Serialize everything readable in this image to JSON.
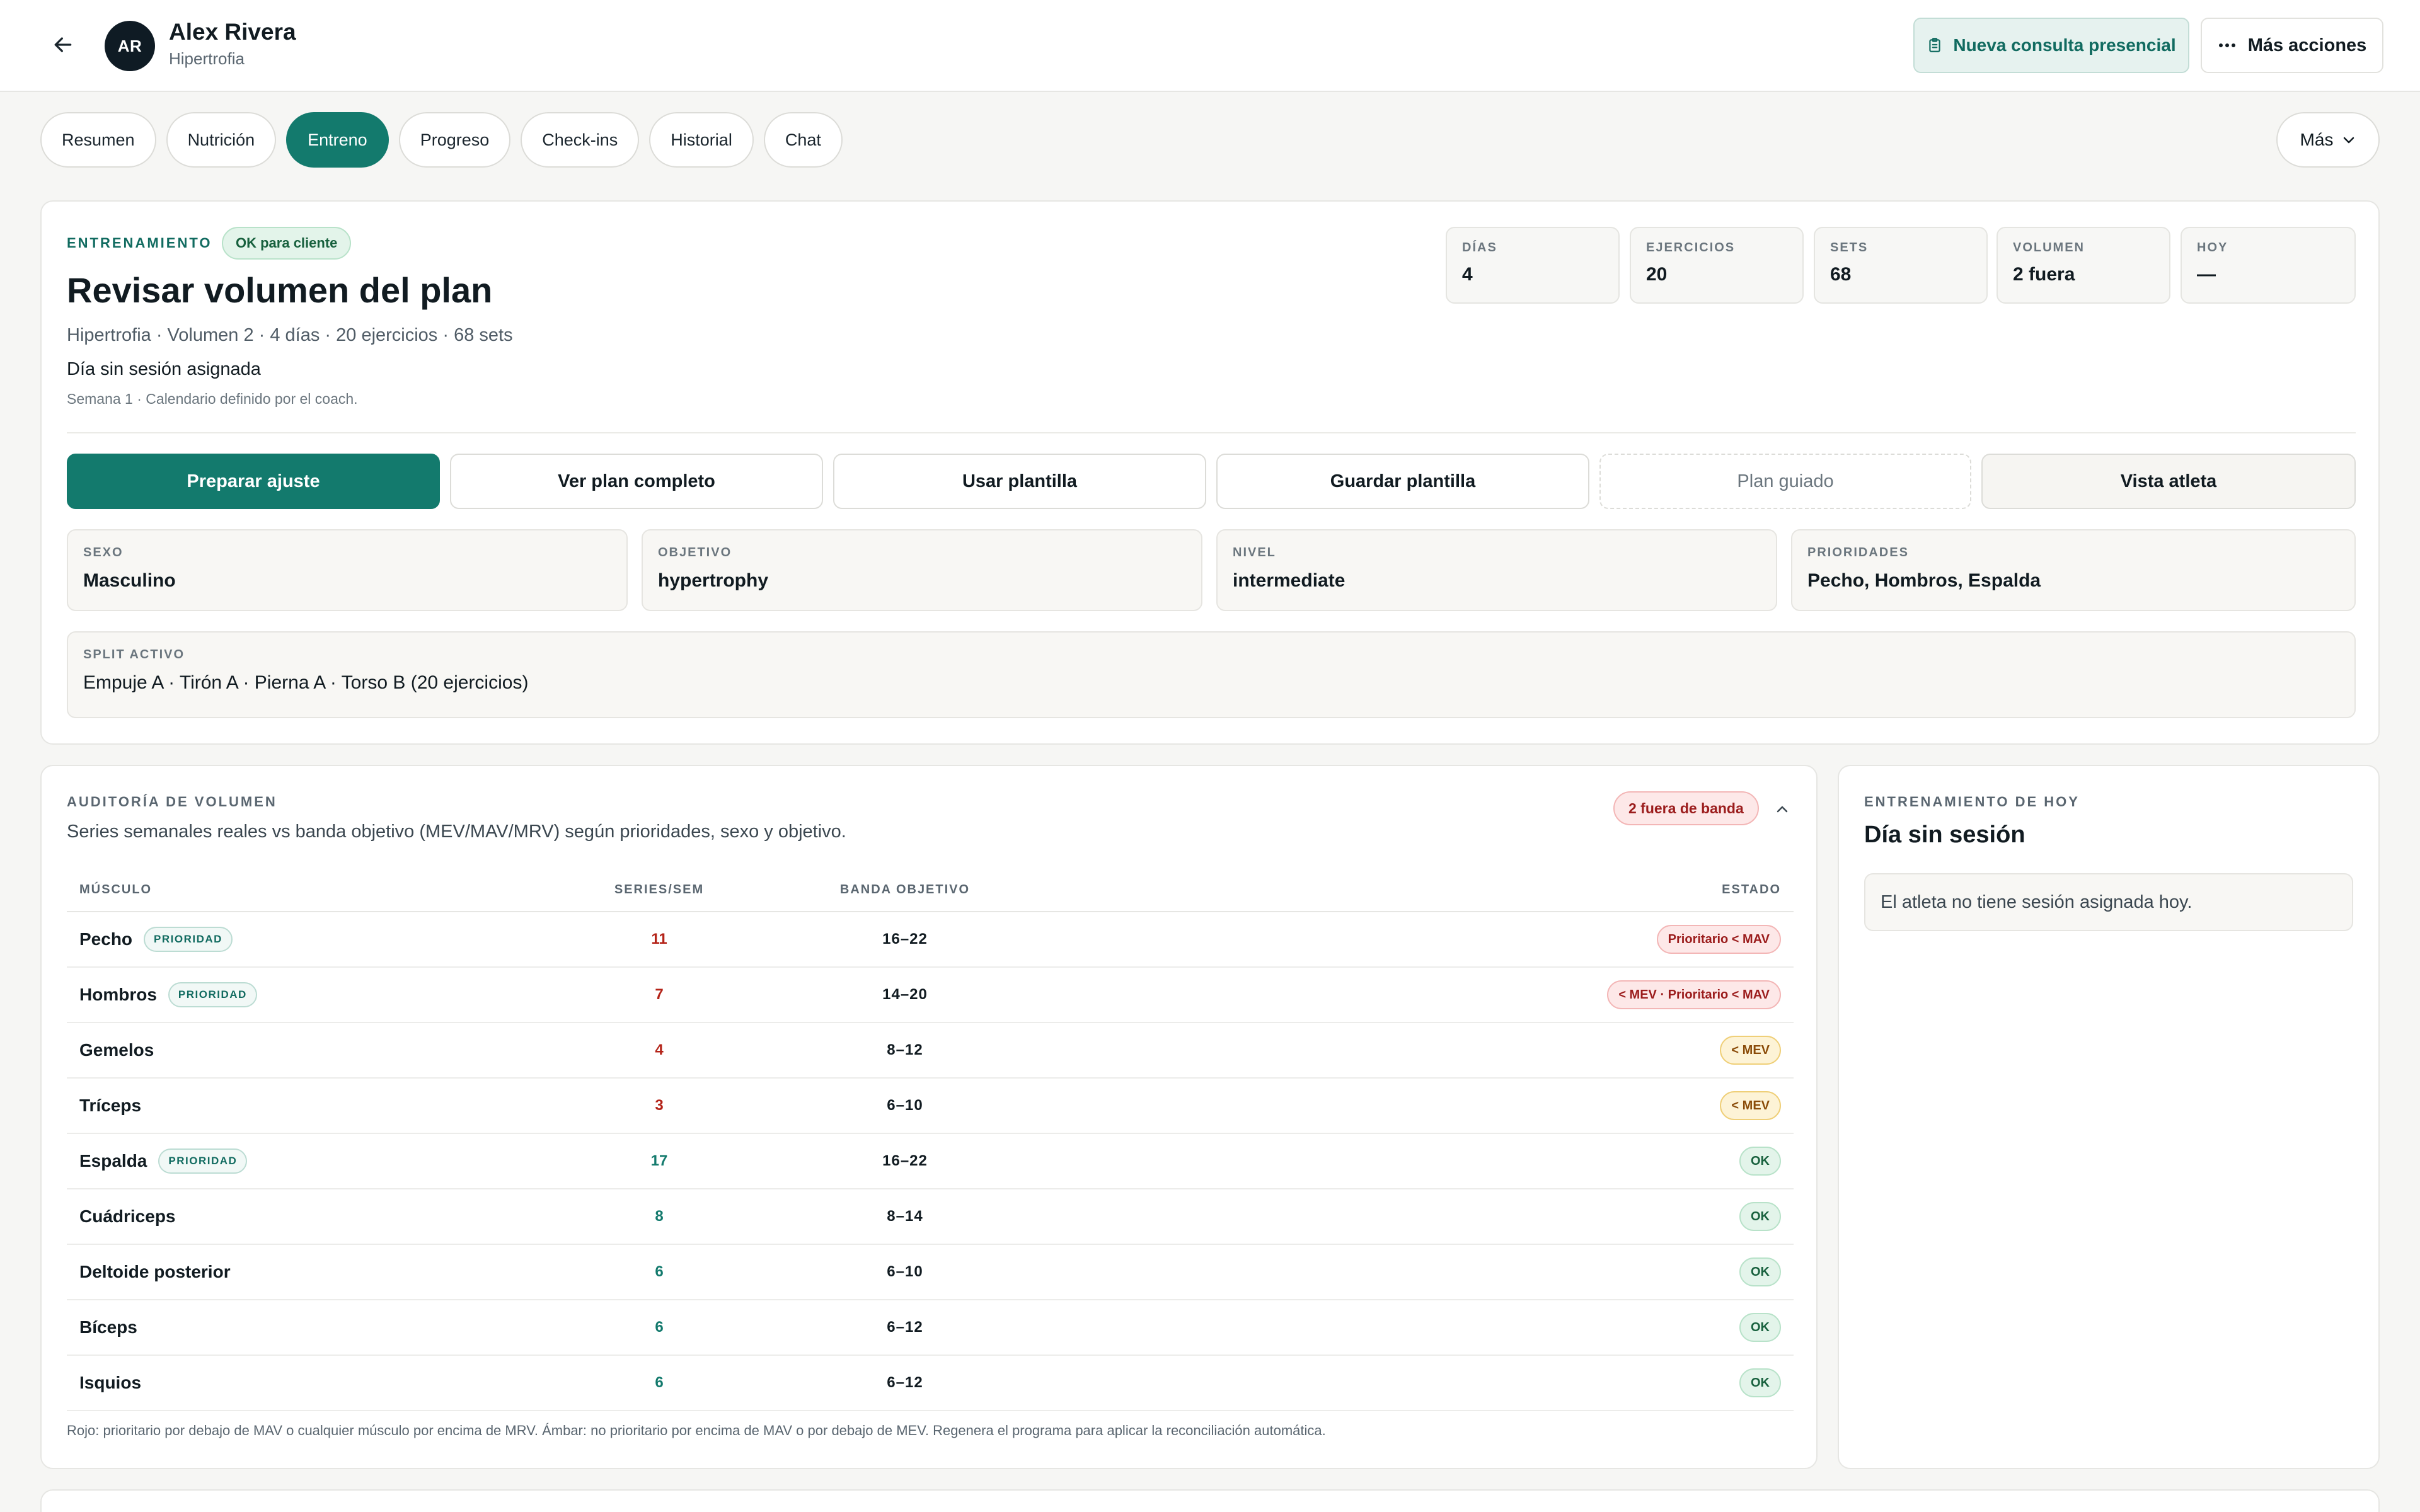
{
  "header": {
    "avatar_initials": "AR",
    "client_name": "Alex Rivera",
    "client_goal": "Hipertrofia",
    "new_consult_label": "Nueva consulta presencial",
    "more_actions_label": "Más acciones"
  },
  "tabs": [
    {
      "label": "Resumen",
      "active": false
    },
    {
      "label": "Nutrición",
      "active": false
    },
    {
      "label": "Entreno",
      "active": true
    },
    {
      "label": "Progreso",
      "active": false
    },
    {
      "label": "Check-ins",
      "active": false
    },
    {
      "label": "Historial",
      "active": false
    },
    {
      "label": "Chat",
      "active": false
    }
  ],
  "more_tab_label": "Más",
  "plan": {
    "eyebrow": "Entrenamiento",
    "status_badge": "OK para cliente",
    "title": "Revisar volumen del plan",
    "meta": "Hipertrofia · Volumen 2 · 4 días · 20 ejercicios · 68 sets",
    "day_status": "Día sin sesión asignada",
    "week_note": "Semana 1 · Calendario definido por el coach.",
    "stats": [
      {
        "label": "Días",
        "value": "4"
      },
      {
        "label": "Ejercicios",
        "value": "20"
      },
      {
        "label": "Sets",
        "value": "68"
      },
      {
        "label": "Volumen",
        "value": "2 fuera"
      },
      {
        "label": "Hoy",
        "value": "—"
      }
    ],
    "actions": {
      "prepare": "Preparar ajuste",
      "view_full": "Ver plan completo",
      "use_template": "Usar plantilla",
      "save_template": "Guardar plantilla",
      "guided_plan": "Plan guiado",
      "athlete_view": "Vista atleta"
    },
    "fields": {
      "sex": {
        "label": "Sexo",
        "value": "Masculino"
      },
      "objective": {
        "label": "Objetivo",
        "value": "hypertrophy"
      },
      "level": {
        "label": "Nivel",
        "value": "intermediate"
      },
      "priorities": {
        "label": "Prioridades",
        "value": "Pecho, Hombros, Espalda"
      },
      "split": {
        "label": "Split activo",
        "value": "Empuje A · Tirón A · Pierna A · Torso B (20 ejercicios)"
      }
    }
  },
  "audit": {
    "eyebrow": "Auditoría de volumen",
    "description": "Series semanales reales vs banda objetivo (MEV/MAV/MRV) según prioridades, sexo y objetivo.",
    "out_badge": "2 fuera de banda",
    "columns": {
      "muscle": "Músculo",
      "series": "Series/sem",
      "band": "Banda objetivo",
      "state": "Estado"
    },
    "priority_label": "Prioridad",
    "rows": [
      {
        "muscle": "Pecho",
        "priority": true,
        "series": "11",
        "series_tone": "red",
        "band": "16–22",
        "state": "Prioritario < MAV",
        "state_tone": "red"
      },
      {
        "muscle": "Hombros",
        "priority": true,
        "series": "7",
        "series_tone": "red",
        "band": "14–20",
        "state": "< MEV · Prioritario < MAV",
        "state_tone": "red"
      },
      {
        "muscle": "Gemelos",
        "priority": false,
        "series": "4",
        "series_tone": "red",
        "band": "8–12",
        "state": "< MEV",
        "state_tone": "amber"
      },
      {
        "muscle": "Tríceps",
        "priority": false,
        "series": "3",
        "series_tone": "red",
        "band": "6–10",
        "state": "< MEV",
        "state_tone": "amber"
      },
      {
        "muscle": "Espalda",
        "priority": true,
        "series": "17",
        "series_tone": "green",
        "band": "16–22",
        "state": "OK",
        "state_tone": "green"
      },
      {
        "muscle": "Cuádriceps",
        "priority": false,
        "series": "8",
        "series_tone": "green",
        "band": "8–14",
        "state": "OK",
        "state_tone": "green"
      },
      {
        "muscle": "Deltoide posterior",
        "priority": false,
        "series": "6",
        "series_tone": "green",
        "band": "6–10",
        "state": "OK",
        "state_tone": "green"
      },
      {
        "muscle": "Bíceps",
        "priority": false,
        "series": "6",
        "series_tone": "green",
        "band": "6–12",
        "state": "OK",
        "state_tone": "green"
      },
      {
        "muscle": "Isquios",
        "priority": false,
        "series": "6",
        "series_tone": "green",
        "band": "6–12",
        "state": "OK",
        "state_tone": "green"
      }
    ],
    "footnote": "Rojo: prioritario por debajo de MAV o cualquier músculo por encima de MRV. Ámbar: no prioritario por encima de MAV o por debajo de MEV. Regenera el programa para aplicar la reconciliación automática."
  },
  "today": {
    "eyebrow": "Entrenamiento de hoy",
    "title": "Día sin sesión",
    "empty_message": "El atleta no tiene sesión asignada hoy."
  },
  "colors": {
    "primary": "#137a6d",
    "danger": "#b42318",
    "warning": "#8a4b08",
    "success": "#17603d"
  }
}
